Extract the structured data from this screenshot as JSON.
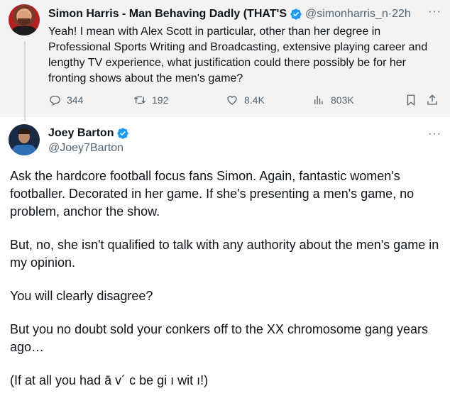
{
  "parent_tweet": {
    "display_name": "Simon Harris - Man Behaving Dadly (THAT'S",
    "handle": "@simonharris_n",
    "separator": " · ",
    "time": "22h",
    "more": "···",
    "text": "Yeah! I mean with Alex Scott in particular, other than her degree in Professional Sports Writing and Broadcasting, extensive playing career and lengthy TV experience, what justification could there possibly be for her fronting shows about the men's game?",
    "stats": {
      "replies": "344",
      "retweets": "192",
      "likes": "8.4K",
      "views": "803K"
    }
  },
  "main_tweet": {
    "display_name": "Joey Barton",
    "handle": "@Joey7Barton",
    "more": "···",
    "paragraphs": [
      "Ask the hardcore football focus fans Simon. Again, fantastic women's footballer. Decorated in her game. If she's presenting a men's game, no problem, anchor the show.",
      "But, no, she isn't qualified to talk with any authority about the men's game in my opinion.",
      "You will clearly disagree?",
      "But you no doubt sold your conkers off to the XX chromosome gang years ago…",
      "(If at all you had ā v´ c be gi ı wit ı!)"
    ]
  },
  "icons": [
    "verified-badge-icon",
    "reply-icon",
    "retweet-icon",
    "like-icon",
    "views-icon",
    "bookmark-icon",
    "share-icon",
    "more-icon"
  ],
  "colors": {
    "verified": "#1d9bf0",
    "secondary_text": "#536471",
    "primary_text": "#0f1419",
    "parent_background": "#f3f3f3"
  }
}
